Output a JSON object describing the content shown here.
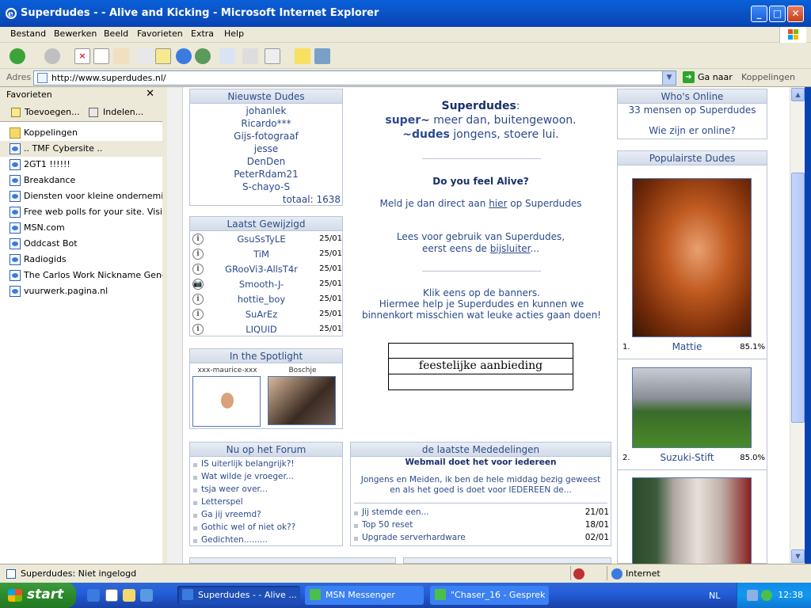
{
  "window": {
    "title": "Superdudes - - Alive and Kicking - Microsoft Internet Explorer",
    "controls": {
      "minimize": "_",
      "maximize": "□",
      "close": "✕"
    }
  },
  "menu": [
    "Bestand",
    "Bewerken",
    "Beeld",
    "Favorieten",
    "Extra",
    "Help"
  ],
  "address": {
    "label": "Adres",
    "url": "http://www.superdudes.nl/",
    "go_label": "Ga naar",
    "links_label": "Koppelingen",
    "go_arrow": "➔",
    "dropdown": "▼"
  },
  "favorites": {
    "title": "Favorieten",
    "close": "✕",
    "add_label": "Toevoegen...",
    "organize_label": "Indelen...",
    "items": [
      {
        "label": "Koppelingen",
        "type": "folder"
      },
      {
        "label": ".. TMF Cybersite ..",
        "type": "page",
        "selected": true
      },
      {
        "label": "2GT1 !!!!!!",
        "type": "page"
      },
      {
        "label": "Breakdance",
        "type": "page"
      },
      {
        "label": "Diensten voor kleine ondernemin...",
        "type": "page"
      },
      {
        "label": "Free web polls for your site. Visit...",
        "type": "page"
      },
      {
        "label": "MSN.com",
        "type": "page"
      },
      {
        "label": "Oddcast Bot",
        "type": "page"
      },
      {
        "label": "Radiogids",
        "type": "page"
      },
      {
        "label": "The Carlos Work Nickname Gener...",
        "type": "page"
      },
      {
        "label": "vuurwerk.pagina.nl",
        "type": "page"
      }
    ]
  },
  "page": {
    "newest": {
      "title": "Nieuwste Dudes",
      "names": [
        "johanlek",
        "Ricardo***",
        "Gijs-fotograaf",
        "jesse",
        "DenDen",
        "PeterRdam21",
        "S-chayo-S"
      ],
      "total": "totaal: 1638"
    },
    "edited": {
      "title": "Laatst Gewijzigd",
      "rows": [
        {
          "name": "GsuSsTyLE",
          "date": "25/01",
          "icon": "i"
        },
        {
          "name": "TiM",
          "date": "25/01",
          "icon": "i"
        },
        {
          "name": "GRooVi3-AllsT4r",
          "date": "25/01",
          "icon": "i"
        },
        {
          "name": "Smooth-J-",
          "date": "25/01",
          "icon": "📷"
        },
        {
          "name": "hottie_boy",
          "date": "25/01",
          "icon": "i"
        },
        {
          "name": "SuArEz",
          "date": "25/01",
          "icon": "i"
        },
        {
          "name": "LIQUID",
          "date": "25/01",
          "icon": "i"
        }
      ]
    },
    "spotlight": {
      "title": "In the Spotlight",
      "people": [
        "xxx-maurice-xxx",
        "Boschje"
      ]
    },
    "forum": {
      "title": "Nu op het Forum",
      "topics": [
        "IS uiterlijk belangrijk?!",
        "Wat wilde je vroeger...",
        "tsja weer over...",
        "Letterspel",
        "Ga jij vreemd?",
        "Gothic wel of niet ok??",
        "Gedichten........."
      ]
    },
    "center": {
      "brand": "Superdudes",
      "colon": ":",
      "line1_bold": "super~",
      "line1_rest": " meer dan, buitengewoon.",
      "line2_bold": "~dudes",
      "line2_rest": " jongens, stoere lui.",
      "alive_q": "Do you feel Alive?",
      "meld_pre": "Meld je dan direct aan ",
      "meld_link": "hier",
      "meld_post": " op Superdudes",
      "lees1": "Lees voor gebruik van Superdudes,",
      "lees2_pre": "eerst eens de ",
      "lees2_link": "bijsluiter",
      "lees2_post": "...",
      "banner1": "Klik eens op de banners.",
      "banner2": "Hiermee help je Superdudes en kunnen we",
      "banner3": "binnenkort misschien wat leuke acties gaan doen!",
      "offer": "feestelijke aanbieding"
    },
    "news": {
      "title": "de laatste Mededelingen",
      "headline": "Webmail doet het voor iedereen",
      "body1": "Jongens en Meiden, ik ben de hele middag bezig geweest",
      "body2": "en als het goed is doet voor IEDEREEN de...",
      "items": [
        {
          "text": "Jij stemde een...",
          "date": "21/01"
        },
        {
          "text": "Top 50 reset",
          "date": "18/01"
        },
        {
          "text": "Upgrade serverhardware",
          "date": "02/01"
        }
      ]
    },
    "online": {
      "title": "Who's Online",
      "count_text": "33 mensen op Superdudes",
      "link": "Wie zijn er online?"
    },
    "popular": {
      "title": "Populairste Dudes",
      "entries": [
        {
          "rank": "1.",
          "name": "Mattie",
          "pct": "85.1%"
        },
        {
          "rank": "2.",
          "name": "Suzuki-Stift",
          "pct": "85.0%"
        }
      ]
    }
  },
  "status": {
    "text": "Superdudes: Niet ingelogd",
    "zone": "Internet"
  },
  "taskbar": {
    "start": "start",
    "tasks": [
      "Superdudes - - Alive ...",
      "MSN Messenger",
      "\"Chaser_16 - Gesprek"
    ],
    "lang": "NL",
    "clock": "12:38"
  },
  "colors": {
    "title_blue": "#0a5fd8",
    "link_blue": "#2c4a8a",
    "start_green": "#2b8a2b"
  }
}
